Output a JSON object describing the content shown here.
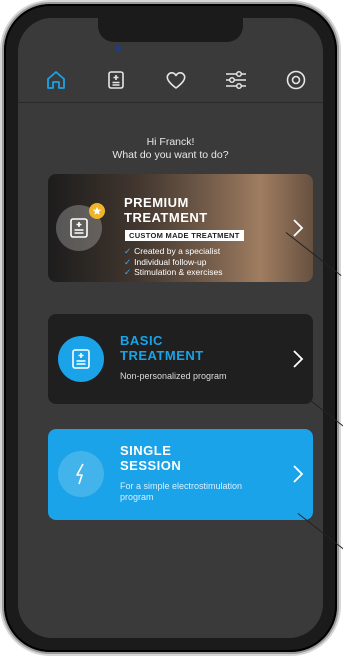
{
  "greeting": {
    "line1": "Hi Franck!",
    "line2": "What do you want to do?"
  },
  "nav": [
    "home-icon",
    "treatment-icon",
    "heart-icon",
    "settings-icon",
    "power-icon"
  ],
  "cards": {
    "premium": {
      "title_line1": "PREMIUM",
      "title_line2": "TREATMENT",
      "badge": "CUSTOM MADE TREATMENT",
      "bullets": [
        "Created by a specialist",
        "Individual follow-up",
        "Stimulation & exercises"
      ]
    },
    "basic": {
      "title_line1": "BASIC",
      "title_line2": "TREATMENT",
      "subtitle": "Non-personalized program"
    },
    "single": {
      "title_line1": "SINGLE",
      "title_line2": "SESSION",
      "subtitle_line1": "For a simple electrostimulation",
      "subtitle_line2": "program"
    }
  },
  "colors": {
    "accent": "#1aa3e8",
    "background": "#3a3a3a",
    "card_dark": "#1f1f1f",
    "star": "#f0b429"
  }
}
